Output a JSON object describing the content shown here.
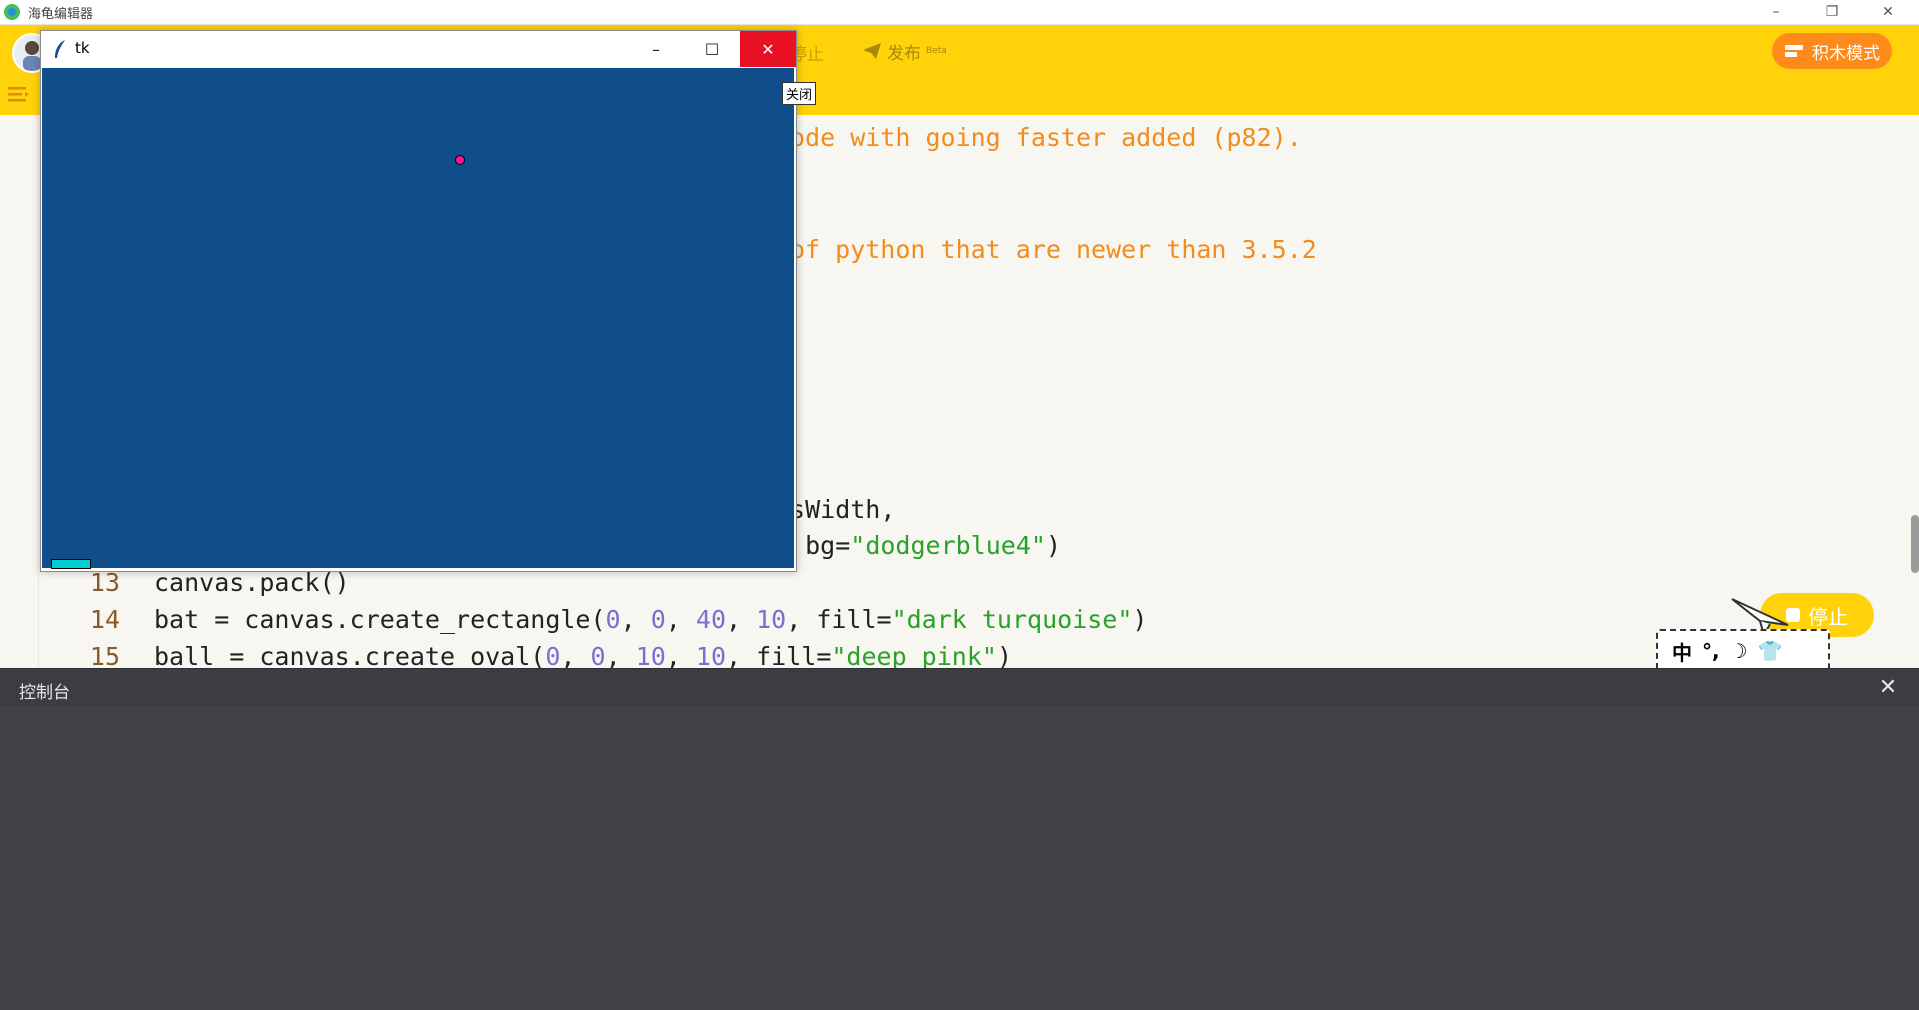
{
  "os": {
    "title": "海龟编辑器",
    "minimize": "–",
    "restore": "❐",
    "close": "✕"
  },
  "header": {
    "stop_partial": "停止",
    "publish_label": "发布",
    "publish_badge": "Beta",
    "block_mode_label": "积木模式"
  },
  "editor": {
    "visible_fragments": [
      "ode with going faster added (p82).",
      "of python that are newer than 3.5.2",
      "asWidth,"
    ],
    "line12_tail_plain": ", bg=",
    "line12_tail_str": "\"dodgerblue4\"",
    "line12_tail_close": ")",
    "lines": [
      {
        "num": "13",
        "text": "canvas.pack()"
      },
      {
        "num": "14",
        "p1": "bat = canvas.create_rectangle(",
        "n1": "0",
        "s1": ", ",
        "n2": "0",
        "s2": ", ",
        "n3": "40",
        "s3": ", ",
        "n4": "10",
        "s4": ", fill=",
        "str": "\"dark turquoise\"",
        "end": ")"
      },
      {
        "num": "15",
        "p1": "ball = canvas.create_oval(",
        "n1": "0",
        "s1": ", ",
        "n2": "0",
        "s2": ", ",
        "n3": "10",
        "s3": ", ",
        "n4": "10",
        "s4": ", fill=",
        "str": "\"deep pink\"",
        "end": ")"
      }
    ]
  },
  "floating": {
    "stop_label": "停止",
    "ime": [
      "中",
      "°,",
      "☽",
      "👕"
    ]
  },
  "console": {
    "title": "控制台",
    "close": "✕"
  },
  "tk": {
    "title": "tk",
    "minimize": "–",
    "maximize": "☐",
    "close": "✕",
    "canvas_bg": "#104e8b",
    "bat_fill": "#00ced1",
    "ball_fill": "#ff1493"
  },
  "tooltip": {
    "text": "关闭"
  },
  "colors": {
    "toolbar": "#ffd20a",
    "block_mode": "#ff8a1c",
    "comment": "#f28c1c",
    "number": "#7a6fd0",
    "string": "#29a12a"
  }
}
